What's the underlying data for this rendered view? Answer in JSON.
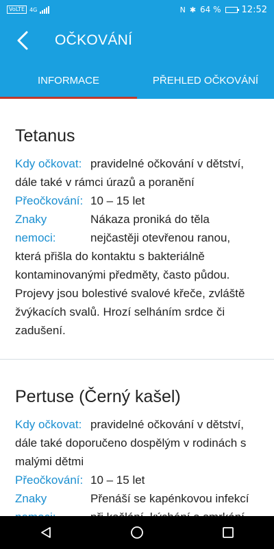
{
  "status_bar": {
    "network": "4G",
    "carrier_badge": "VoLTE",
    "battery": "64 %",
    "battery_level": 0.64,
    "time": "12:52"
  },
  "app_bar": {
    "title": "OČKOVÁNÍ"
  },
  "tabs": [
    {
      "label": "INFORMACE",
      "active": true
    },
    {
      "label": "PŘEHLED OČKOVÁNÍ",
      "active": false
    }
  ],
  "diseases": [
    {
      "name": "Tetanus",
      "when_label": "Kdy očkovat:",
      "when": "pravidelné očkování v dětství, dále také v rámci úrazů a poranění",
      "revacc_label": "Přeočkování:",
      "revacc": "10 – 15 let",
      "signs_label": "Znaky nemoci:",
      "signs": "Nákaza proniká do těla nejčastěji otevřenou ranou, která přišla do kontaktu s bakteriálně kontaminovanými předměty, často půdou. Projevy jsou bolestivé svalové křeče, zvláště žvýkacích svalů. Hrozí selháním srdce či zadušení."
    },
    {
      "name": "Pertuse (Černý kašel)",
      "when_label": "Kdy očkovat:",
      "when": "pravidelné očkování v dětství, dále také doporučeno dospělým v rodinách s malými dětmi",
      "revacc_label": "Přeočkování:",
      "revacc": "10 – 15 let",
      "signs_label": "Znaky nemoci:",
      "signs": "Přenáší se kapénkovou infekcí při kašlání, kýchání a smrkání."
    }
  ],
  "colors": {
    "primary": "#1aa0e0",
    "accent": "#c0392b",
    "label": "#1a8fd1"
  },
  "icons": {
    "back": "chevron-left-icon",
    "nav_back": "triangle-back-icon",
    "nav_home": "circle-home-icon",
    "nav_recents": "square-recents-icon"
  }
}
